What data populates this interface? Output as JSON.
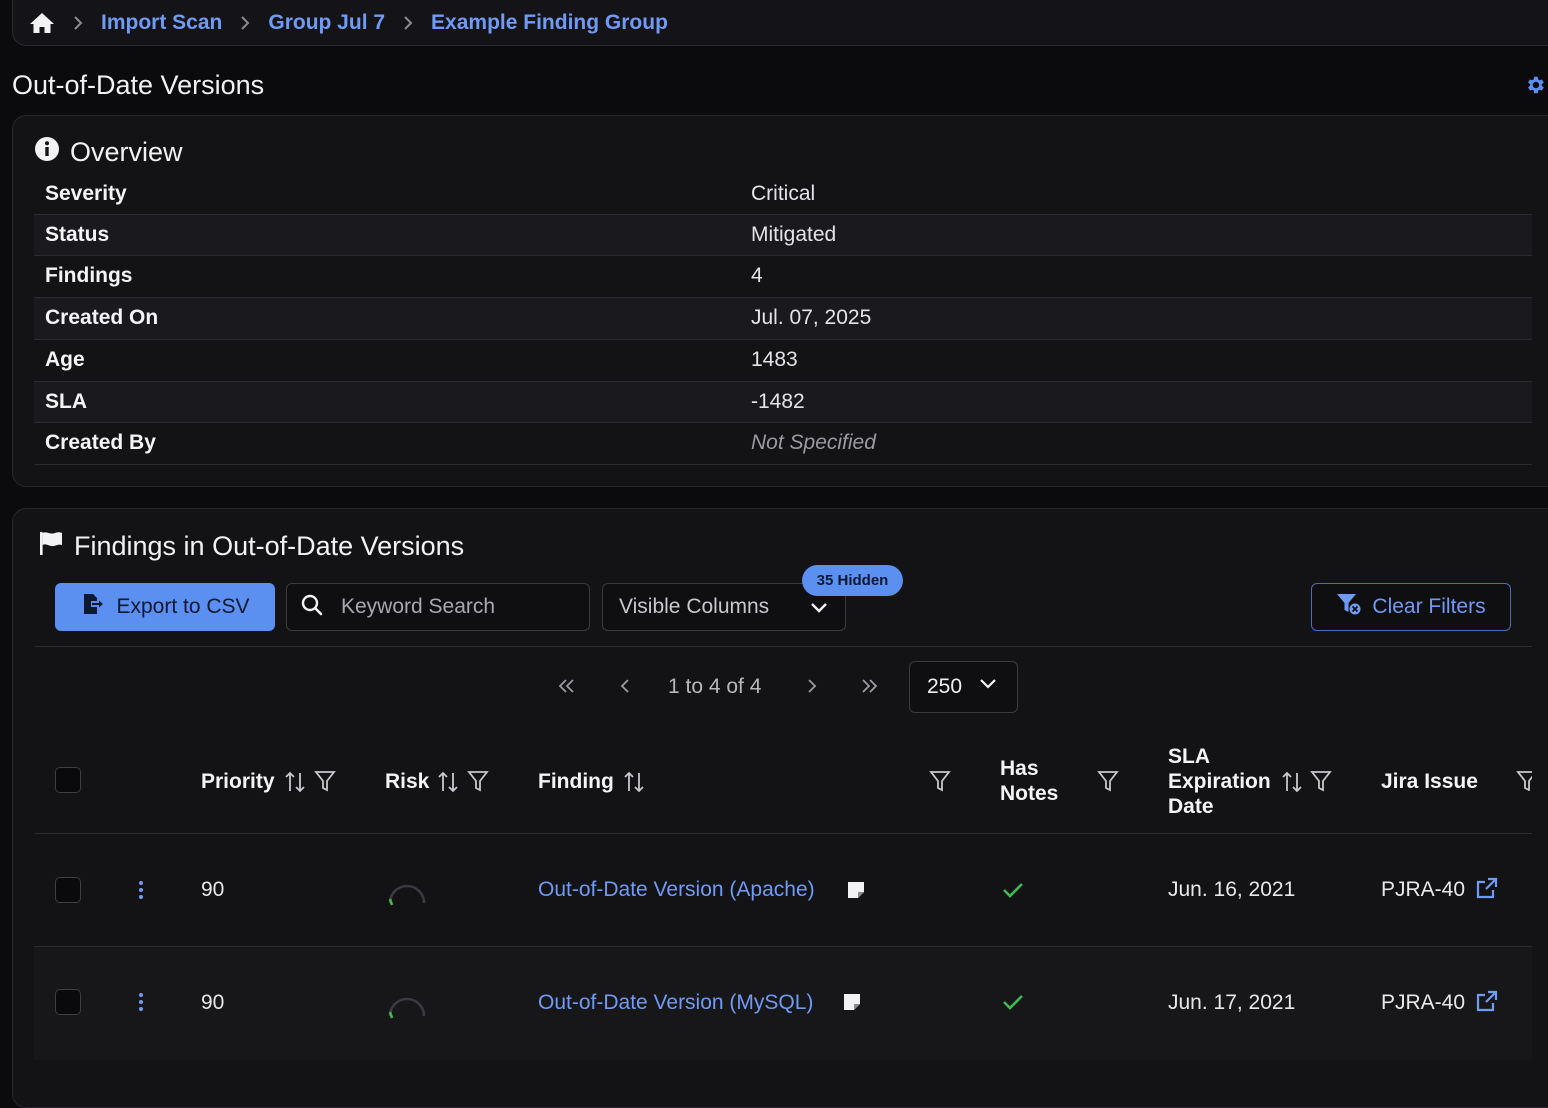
{
  "breadcrumb": {
    "items": [
      "Import Scan",
      "Group Jul 7",
      "Example Finding Group"
    ]
  },
  "page": {
    "title": "Out-of-Date Versions"
  },
  "overview": {
    "title": "Overview",
    "rows": [
      {
        "label": "Severity",
        "value": "Critical"
      },
      {
        "label": "Status",
        "value": "Mitigated"
      },
      {
        "label": "Findings",
        "value": "4"
      },
      {
        "label": "Created On",
        "value": "Jul. 07, 2025"
      },
      {
        "label": "Age",
        "value": "1483"
      },
      {
        "label": "SLA",
        "value": "-1482"
      },
      {
        "label": "Created By",
        "value": "Not Specified"
      }
    ]
  },
  "findings": {
    "title": "Findings in Out-of-Date Versions",
    "export_label": "Export to CSV",
    "search_placeholder": "Keyword Search",
    "visible_columns_label": "Visible Columns",
    "hidden_badge": "35 Hidden",
    "clear_filters_label": "Clear Filters",
    "pagination": {
      "range_text": "1 to 4 of 4",
      "page_size": "250"
    },
    "columns": {
      "priority": "Priority",
      "risk": "Risk",
      "finding": "Finding",
      "has_notes_1": "Has",
      "has_notes_2": "Notes",
      "sla_1": "SLA",
      "sla_2": "Expiration",
      "sla_3": "Date",
      "jira": "Jira Issue"
    },
    "rows": [
      {
        "priority": "90",
        "finding": "Out-of-Date Version (Apache)",
        "has_notes": true,
        "sla_date": "Jun. 16, 2021",
        "jira": "PJRA-40"
      },
      {
        "priority": "90",
        "finding": "Out-of-Date Version (MySQL)",
        "has_notes": true,
        "sla_date": "Jun. 17, 2021",
        "jira": "PJRA-40"
      }
    ]
  },
  "colors": {
    "accent": "#5b8ff0",
    "link": "#6f9bf5",
    "check": "#3fb950",
    "background": "#0b0b0e"
  }
}
